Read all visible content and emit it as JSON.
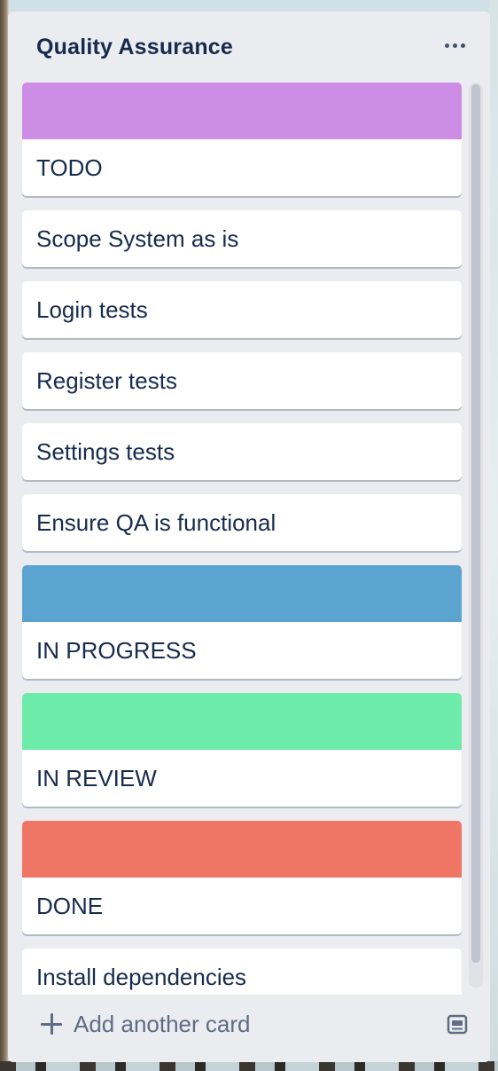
{
  "list": {
    "title": "Quality Assurance",
    "menu_icon": "more-horizontal-icon"
  },
  "cards": [
    {
      "title": "TODO",
      "cover_color": "#cd8de5"
    },
    {
      "title": "Scope System as is"
    },
    {
      "title": "Login tests"
    },
    {
      "title": "Register tests"
    },
    {
      "title": "Settings tests"
    },
    {
      "title": "Ensure QA is functional"
    },
    {
      "title": "IN PROGRESS",
      "cover_color": "#5ba4cf"
    },
    {
      "title": "IN REVIEW",
      "cover_color": "#6deca9"
    },
    {
      "title": "DONE",
      "cover_color": "#ef7564"
    },
    {
      "title": "Install dependencies"
    }
  ],
  "composer": {
    "add_label": "Add another card",
    "add_icon": "plus-icon",
    "template_icon": "card-template-icon"
  },
  "colors": {
    "list_background": "#ebecf0",
    "text": "#172b4d",
    "muted_text": "#5e6c84"
  }
}
